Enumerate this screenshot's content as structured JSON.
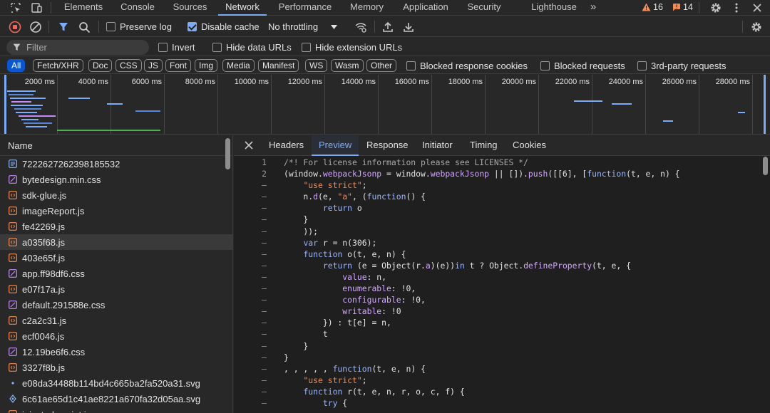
{
  "main_tabs": [
    "Elements",
    "Console",
    "Sources",
    "Network",
    "Performance",
    "Memory",
    "Application",
    "Security",
    "Lighthouse"
  ],
  "active_tab": "Network",
  "more_tabs": "»",
  "counters": {
    "warnings": "16",
    "issues": "14"
  },
  "toolbar": {
    "preserve_log": "Preserve log",
    "disable_cache": "Disable cache",
    "throttling": "No throttling"
  },
  "filter": {
    "placeholder": "Filter",
    "invert": "Invert",
    "hide_data_urls": "Hide data URLs",
    "hide_extension_urls": "Hide extension URLs"
  },
  "types": [
    "All",
    "Fetch/XHR",
    "Doc",
    "CSS",
    "JS",
    "Font",
    "Img",
    "Media",
    "Manifest",
    "WS",
    "Wasm",
    "Other"
  ],
  "type_checkboxes": [
    "Blocked response cookies",
    "Blocked requests",
    "3rd-party requests"
  ],
  "timeline_ticks": [
    "2000 ms",
    "4000 ms",
    "6000 ms",
    "8000 ms",
    "10000 ms",
    "12000 ms",
    "14000 ms",
    "16000 ms",
    "18000 ms",
    "20000 ms",
    "22000 ms",
    "24000 ms",
    "26000 ms",
    "28000 ms"
  ],
  "request_list": {
    "header": "Name",
    "items": [
      {
        "name": "7222627262398185532",
        "type": "doc"
      },
      {
        "name": "bytedesign.min.css",
        "type": "css"
      },
      {
        "name": "sdk-glue.js",
        "type": "js"
      },
      {
        "name": "imageReport.js",
        "type": "js"
      },
      {
        "name": "fe42269.js",
        "type": "js"
      },
      {
        "name": "a035f68.js",
        "type": "js"
      },
      {
        "name": "403e65f.js",
        "type": "js"
      },
      {
        "name": "app.ff98df6.css",
        "type": "css"
      },
      {
        "name": "e07f17a.js",
        "type": "js"
      },
      {
        "name": "default.291588e.css",
        "type": "css"
      },
      {
        "name": "c2a2c31.js",
        "type": "js"
      },
      {
        "name": "ecf0046.js",
        "type": "js"
      },
      {
        "name": "12.19be6f6.css",
        "type": "css"
      },
      {
        "name": "3327f8b.js",
        "type": "js"
      },
      {
        "name": "e08da34488b114bd4c665ba2fa520a31.svg",
        "type": "img"
      },
      {
        "name": "6c61ae65d1c41ae8221a670fa32d05aa.svg",
        "type": "img2"
      },
      {
        "name": "injected_script.js",
        "type": "js"
      }
    ],
    "selected_index": 5
  },
  "detail_tabs": [
    "Headers",
    "Preview",
    "Response",
    "Initiator",
    "Timing",
    "Cookies"
  ],
  "detail_active": "Preview",
  "colors": {
    "accent": "#7cacf8",
    "chip_active": "#0b57d0",
    "record_red": "#ee675c",
    "warning_orange": "#f28b54",
    "keyword": "#9ab6ff",
    "string": "#f28b54"
  }
}
